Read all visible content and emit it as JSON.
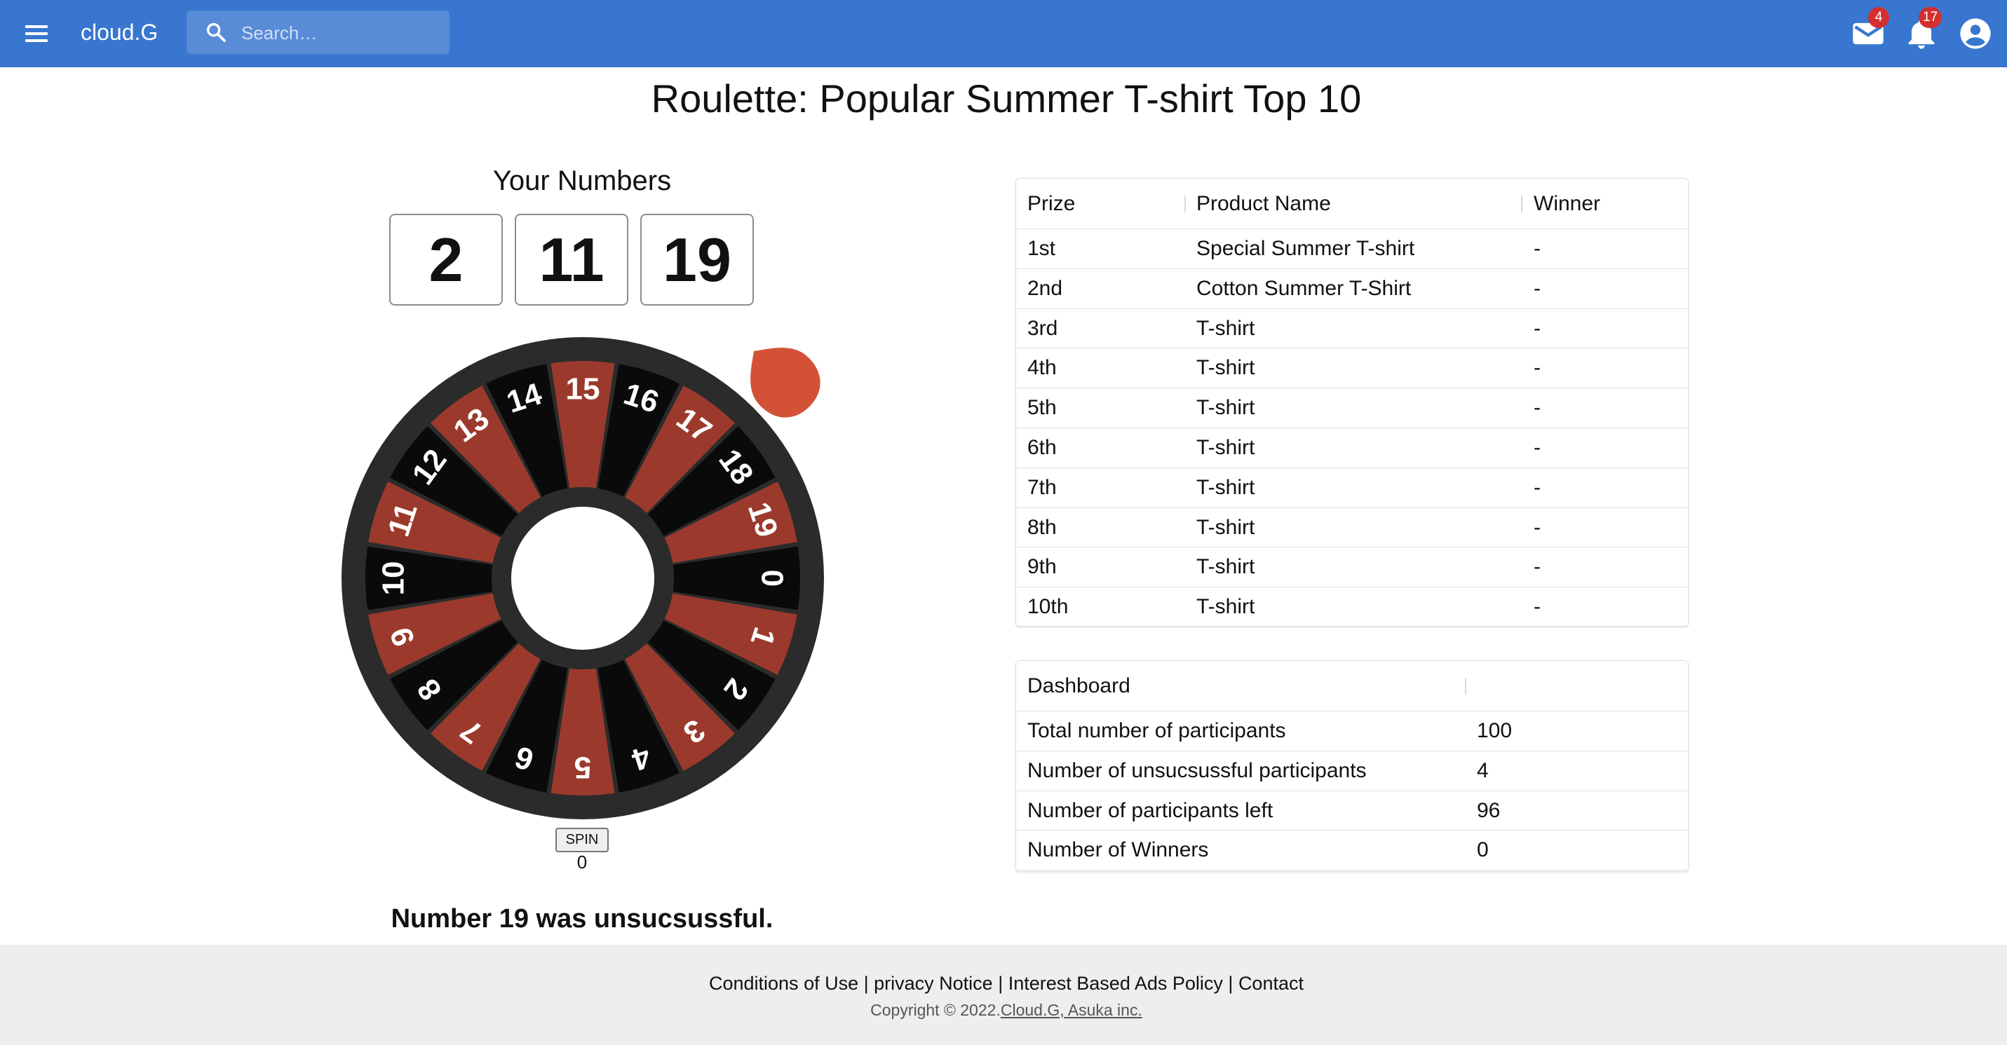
{
  "appbar": {
    "brand": "cloud.G",
    "search_placeholder": "Search…",
    "mail_badge": "4",
    "notifications_badge": "17",
    "color": "#3876d0",
    "icons": [
      "menu-icon",
      "search-icon",
      "mail-icon",
      "bell-icon",
      "account-circle-icon"
    ]
  },
  "page": {
    "title": "Roulette: Popular Summer T-shirt Top 10"
  },
  "your_numbers": {
    "label": "Your Numbers",
    "values": [
      "2",
      "11",
      "19"
    ]
  },
  "wheel": {
    "numbers": [
      "0",
      "1",
      "2",
      "3",
      "4",
      "5",
      "6",
      "7",
      "8",
      "9",
      "10",
      "11",
      "12",
      "13",
      "14",
      "15",
      "16",
      "17",
      "18",
      "19"
    ],
    "red_color": "#9b3a2c",
    "black_color": "#0a0a0a",
    "rim_color": "#2b2b2b",
    "pointer_color": "#d35237"
  },
  "spin": {
    "button_label": "SPIN",
    "count": "0"
  },
  "result_message": "Number 19 was unsucsussful.",
  "prize_table": {
    "headers": [
      "Prize",
      "Product Name",
      "Winner"
    ],
    "rows": [
      [
        "1st",
        "Special Summer T-shirt",
        "-"
      ],
      [
        "2nd",
        "Cotton Summer T-Shirt",
        "-"
      ],
      [
        "3rd",
        "T-shirt",
        "-"
      ],
      [
        "4th",
        "T-shirt",
        "-"
      ],
      [
        "5th",
        "T-shirt",
        "-"
      ],
      [
        "6th",
        "T-shirt",
        "-"
      ],
      [
        "7th",
        "T-shirt",
        "-"
      ],
      [
        "8th",
        "T-shirt",
        "-"
      ],
      [
        "9th",
        "T-shirt",
        "-"
      ],
      [
        "10th",
        "T-shirt",
        "-"
      ]
    ]
  },
  "dashboard": {
    "header": "Dashboard",
    "rows": [
      [
        "Total number of participants",
        "100"
      ],
      [
        "Number of unsucsussful participants",
        "4"
      ],
      [
        "Number of participants left",
        "96"
      ],
      [
        "Number of Winners",
        "0"
      ]
    ]
  },
  "footer": {
    "links": [
      "Conditions of Use",
      "privacy Notice",
      "Interest Based Ads Policy",
      "Contact"
    ],
    "separator": " | ",
    "copyright_prefix": "Copyright © 2022.",
    "copyright_link": "Cloud.G, Asuka inc."
  }
}
